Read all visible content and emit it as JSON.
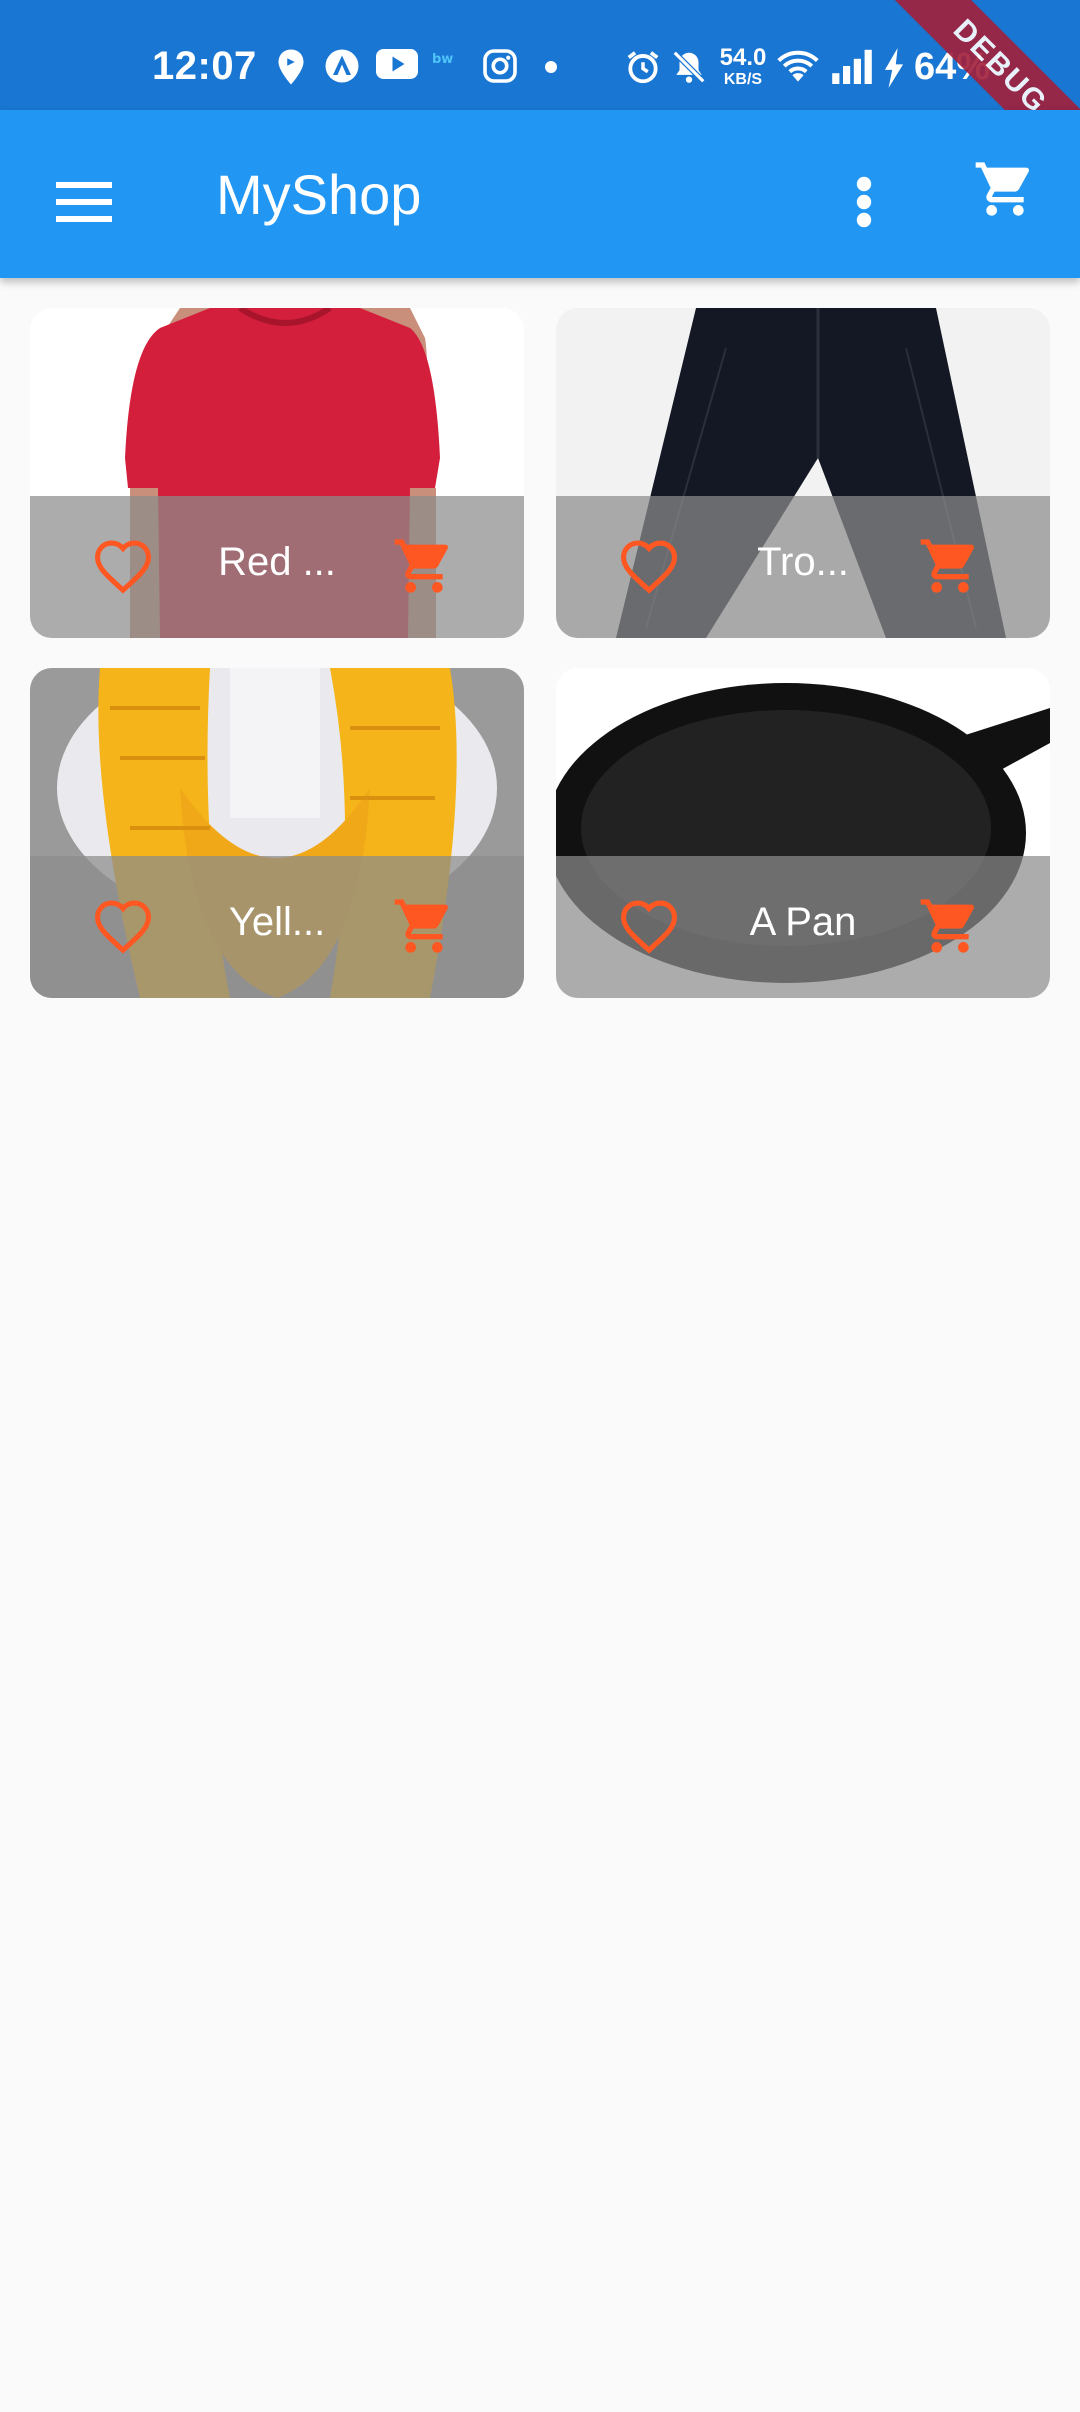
{
  "status_bar": {
    "time": "12:07",
    "net_speed_value": "54.0",
    "net_speed_unit": "KB/S",
    "battery": "64%",
    "debug_label": "DEBUG",
    "icons": [
      "location-icon",
      "arc-icon",
      "youtube-icon",
      "app-icon",
      "instagram-icon",
      "dot-icon",
      "alarm-icon",
      "mute-icon",
      "wifi-icon",
      "signal-icon",
      "charging-icon"
    ]
  },
  "app_bar": {
    "title": "MyShop",
    "menu_icon": "hamburger-icon",
    "more_icon": "more-vert-icon",
    "cart_icon": "shopping-cart-icon"
  },
  "products": [
    {
      "title": "Red ...",
      "image": "red-shirt"
    },
    {
      "title": "Tro...",
      "image": "trousers"
    },
    {
      "title": "Yell...",
      "image": "yellow-scarf"
    },
    {
      "title": "A Pan",
      "image": "pan"
    }
  ],
  "colors": {
    "status_bar": "#1976d2",
    "app_bar": "#2196f3",
    "accent": "#ff5722",
    "background": "#fafafa"
  }
}
